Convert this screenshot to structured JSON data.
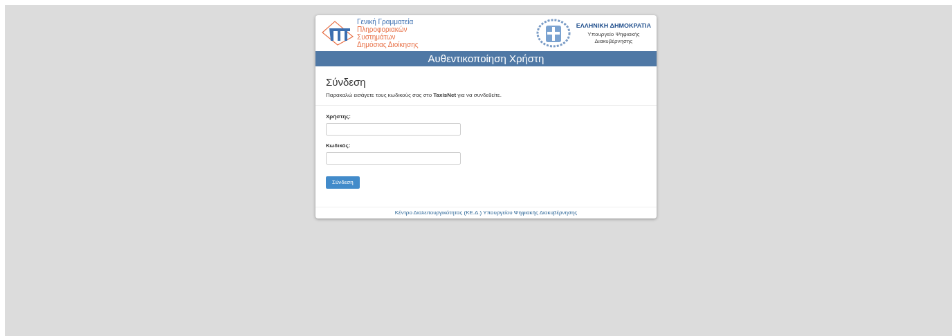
{
  "header": {
    "org_logo_lines": [
      "Γενική Γραμματεία",
      "Πληροφοριακών",
      "Συστημάτων",
      "Δημόσιας Διοίκησης"
    ],
    "state_title": "ΕΛΛΗΝΙΚΗ ΔΗΜΟΚΡΑΤΙΑ",
    "ministry_lines": [
      "Υπουργείο Ψηφιακής",
      "Διακυβέρνησης"
    ]
  },
  "title_bar": "Αυθεντικοποίηση Χρήστη",
  "login": {
    "heading": "Σύνδεση",
    "instructions": "Παρακαλώ εισάγετε τους κωδικούς σας στο **TaxisNet** για να συνδεθείτε.",
    "fields": [
      {
        "label": "Χρήστης:"
      },
      {
        "label": "Κωδικός:"
      }
    ],
    "submit": "Σύνδεση"
  },
  "footer": "Κέντρο Διαλειτουργικότητας (ΚΕ.Δ.) Υπουργείου Ψηφιακής Διακυβέρνησης"
}
